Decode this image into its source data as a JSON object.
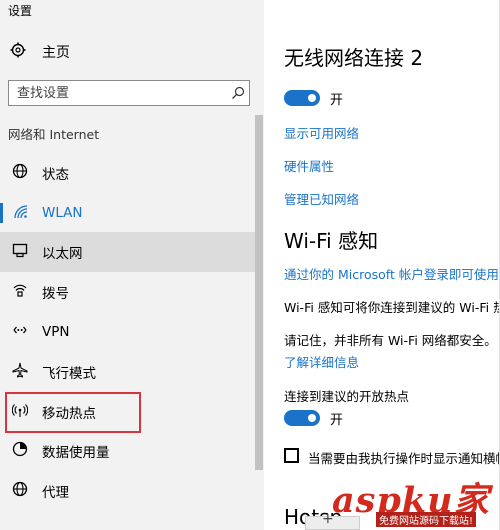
{
  "window": {
    "title": "设置"
  },
  "sidebar": {
    "home_label": "主页",
    "search_placeholder": "查找设置",
    "section_title": "网络和 Internet",
    "items": [
      {
        "label": "状态",
        "icon": "globe-icon"
      },
      {
        "label": "WLAN",
        "icon": "wifi-icon",
        "active": true
      },
      {
        "label": "以太网",
        "icon": "ethernet-icon"
      },
      {
        "label": "拨号",
        "icon": "dialup-icon"
      },
      {
        "label": "VPN",
        "icon": "vpn-icon"
      },
      {
        "label": "飞行模式",
        "icon": "airplane-icon"
      },
      {
        "label": "移动热点",
        "icon": "hotspot-icon"
      },
      {
        "label": "数据使用量",
        "icon": "data-usage-icon"
      },
      {
        "label": "代理",
        "icon": "globe-icon"
      }
    ]
  },
  "main": {
    "adapter_title": "无线网络连接 2",
    "wifi_toggle_label": "开",
    "links": [
      "显示可用网络",
      "硬件属性",
      "管理已知网络"
    ],
    "wifi_sense_title": "Wi-Fi 感知",
    "wifi_sense_link": "通过你的 Microsoft 帐户登录即可使用",
    "wifi_sense_desc": "Wi-Fi 感知可将你连接到建议的 Wi-Fi 热",
    "wifi_sense_note": "请记住，并非所有 Wi-Fi 网络都安全。",
    "learn_more": "了解详细信息",
    "open_hotspots_label": "连接到建议的开放热点",
    "open_hotspots_toggle_label": "开",
    "notify_checkbox_label": "当需要由我执行操作时显示通知横幅",
    "hotspot_partial_title": "Hotsp"
  },
  "watermark": {
    "brand": "aspku",
    "brand_tail": "家",
    "subtitle": "免费网站源码下载站!"
  },
  "colors": {
    "accent": "#1a73c8",
    "highlight_border": "#d6353f",
    "sidebar_bg": "#f2f2f2"
  }
}
